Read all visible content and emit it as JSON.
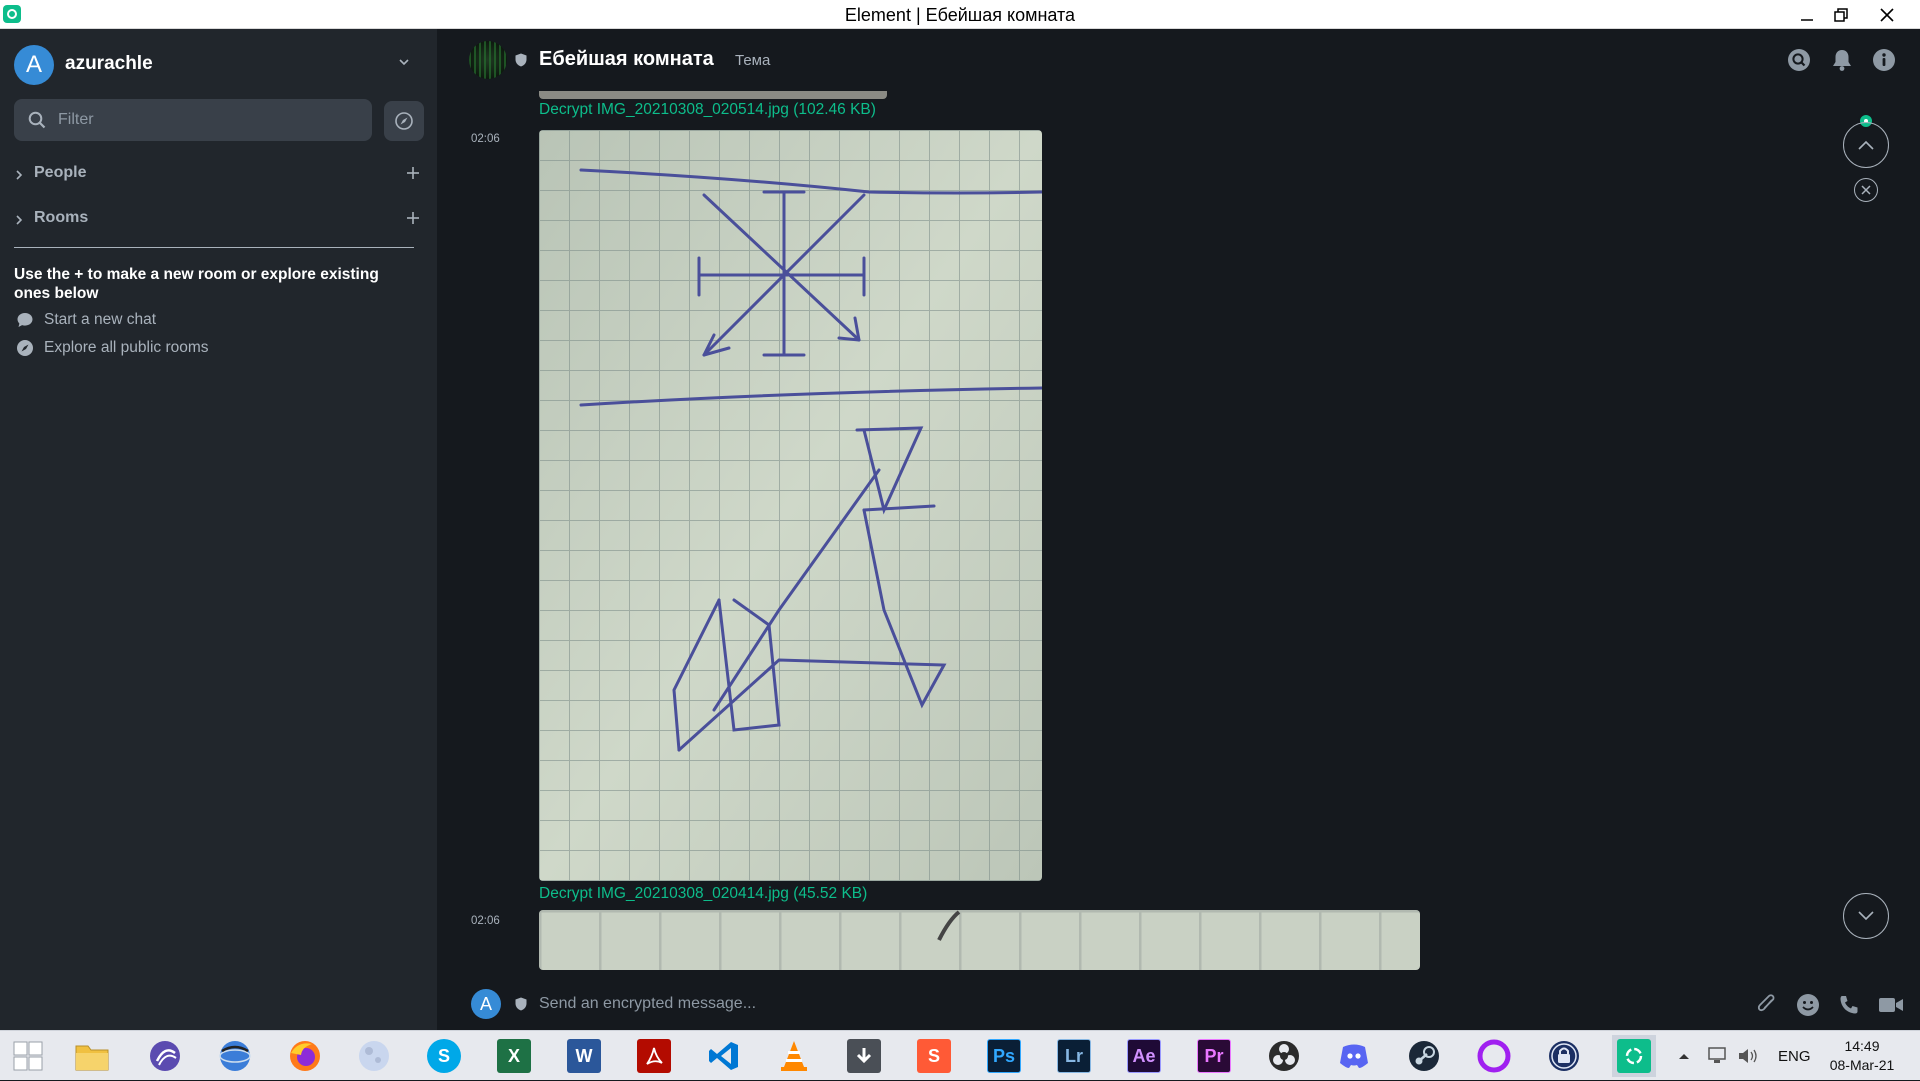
{
  "window": {
    "title": "Element | Ебейшая комната"
  },
  "user": {
    "initial": "A",
    "name": "azurachle"
  },
  "sidebar": {
    "filter_placeholder": "Filter",
    "sections": [
      {
        "label": "People"
      },
      {
        "label": "Rooms"
      }
    ],
    "hint": "Use the + to make a new room or explore existing ones below",
    "links": [
      {
        "label": "Start a new chat"
      },
      {
        "label": "Explore all public rooms"
      }
    ]
  },
  "room": {
    "name": "Ебейшая комната",
    "topic": "Тема"
  },
  "timeline": {
    "file_1": "Decrypt IMG_20210308_020514.jpg (102.46 KB)",
    "msg_1_time": "02:06",
    "file_2": "Decrypt IMG_20210308_020414.jpg (45.52 KB)",
    "msg_2_time": "02:06"
  },
  "composer": {
    "avatar_initial": "A",
    "placeholder": "Send an encrypted message..."
  },
  "taskbar": {
    "apps": [
      {
        "name": "windows-start",
        "glyph": ""
      },
      {
        "name": "file-explorer",
        "glyph": ""
      },
      {
        "name": "torrent-client",
        "glyph": ""
      },
      {
        "name": "browser-globe",
        "glyph": ""
      },
      {
        "name": "firefox",
        "glyph": ""
      },
      {
        "name": "moon-app",
        "glyph": ""
      },
      {
        "name": "skype",
        "glyph": "S"
      },
      {
        "name": "excel",
        "glyph": "X"
      },
      {
        "name": "word",
        "glyph": "W"
      },
      {
        "name": "acrobat",
        "glyph": ""
      },
      {
        "name": "vscode",
        "glyph": ""
      },
      {
        "name": "vlc",
        "glyph": ""
      },
      {
        "name": "downloader",
        "glyph": ""
      },
      {
        "name": "sublime",
        "glyph": "S"
      },
      {
        "name": "photoshop",
        "glyph": "Ps"
      },
      {
        "name": "lightroom",
        "glyph": "Lr"
      },
      {
        "name": "after-effects",
        "glyph": "Ae"
      },
      {
        "name": "premiere",
        "glyph": "Pr"
      },
      {
        "name": "obs",
        "glyph": ""
      },
      {
        "name": "discord",
        "glyph": ""
      },
      {
        "name": "steam",
        "glyph": ""
      },
      {
        "name": "opera",
        "glyph": ""
      },
      {
        "name": "vpn-lock",
        "glyph": ""
      },
      {
        "name": "element",
        "glyph": ""
      }
    ],
    "language": "ENG",
    "time": "14:49",
    "date": "08-Mar-21"
  },
  "colors": {
    "accent": "#0dbd8b",
    "avatar": "#368bd6",
    "sidebar_bg": "#21262c",
    "main_bg": "#15191e"
  }
}
